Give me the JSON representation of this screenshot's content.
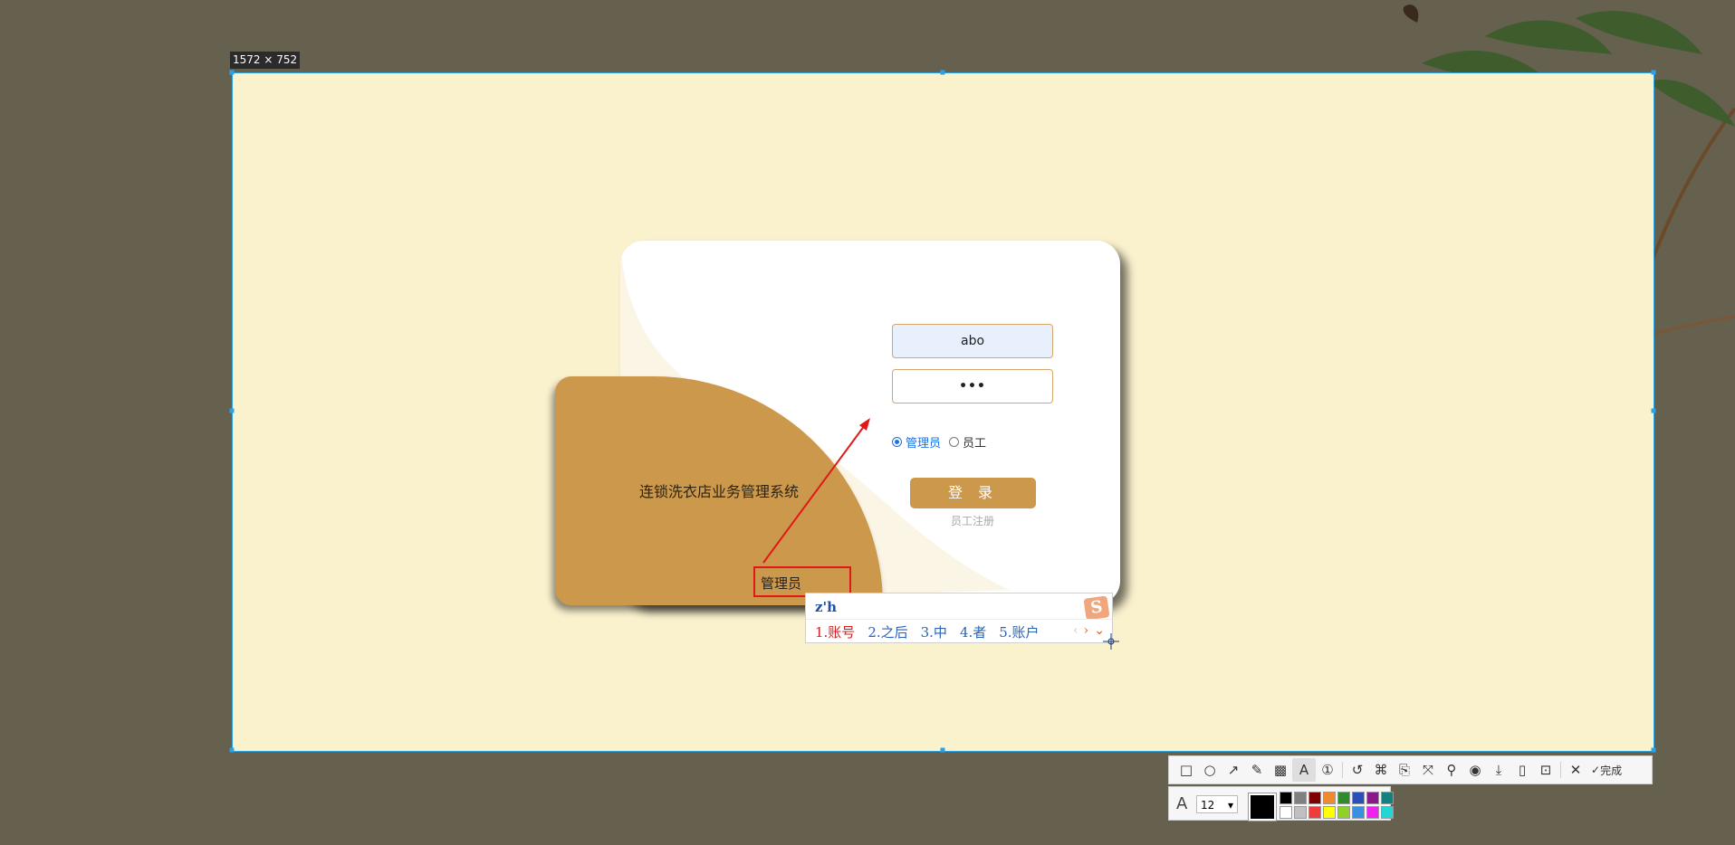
{
  "selection": {
    "size_label": "1572 × 752"
  },
  "login": {
    "system_title": "连锁洗衣店业务管理系统",
    "username_value": "abo",
    "password_value": "•••",
    "roles": [
      {
        "label": "管理员",
        "checked": true
      },
      {
        "label": "员工",
        "checked": false
      }
    ],
    "login_button": "登 录",
    "register_link": "员工注册"
  },
  "annotation": {
    "text_box": "管理员",
    "color": "#e01818"
  },
  "ime": {
    "composition": "z'h",
    "candidates": [
      "1.账号",
      "2.之后",
      "3.中",
      "4.者",
      "5.账户"
    ],
    "logo": "S"
  },
  "toolbar": {
    "tools": [
      {
        "name": "rectangle-tool-icon",
        "glyph": "□"
      },
      {
        "name": "ellipse-tool-icon",
        "glyph": "○"
      },
      {
        "name": "arrow-tool-icon",
        "glyph": "↗"
      },
      {
        "name": "pen-tool-icon",
        "glyph": "✎"
      },
      {
        "name": "mosaic-tool-icon",
        "glyph": "▩"
      },
      {
        "name": "text-tool-icon",
        "glyph": "A"
      },
      {
        "name": "number-tool-icon",
        "glyph": "①"
      },
      {
        "name": "undo-icon",
        "glyph": "↺"
      },
      {
        "name": "ocr-icon",
        "glyph": "⌘"
      },
      {
        "name": "translate-icon",
        "glyph": "⎘"
      },
      {
        "name": "long-capture-icon",
        "glyph": "⤧"
      },
      {
        "name": "pin-icon",
        "glyph": "⚲"
      },
      {
        "name": "record-icon",
        "glyph": "◉"
      },
      {
        "name": "download-icon",
        "glyph": "⤓"
      },
      {
        "name": "phone-icon",
        "glyph": "▯"
      },
      {
        "name": "bookmark-icon",
        "glyph": "⊡"
      },
      {
        "name": "close-icon",
        "glyph": "✕"
      }
    ],
    "done_label": "完成"
  },
  "subbar": {
    "font_size": "12",
    "current_color": "#000000",
    "palette": [
      "#000000",
      "#808080",
      "#800000",
      "#f28a2c",
      "#2e8b2e",
      "#2b4fb8",
      "#8a1a8a",
      "#148080",
      "#ffffff",
      "#c0c0c0",
      "#ee3b3b",
      "#ffff00",
      "#8fd12a",
      "#3b8fe0",
      "#ee22ee",
      "#22d6d6"
    ]
  }
}
